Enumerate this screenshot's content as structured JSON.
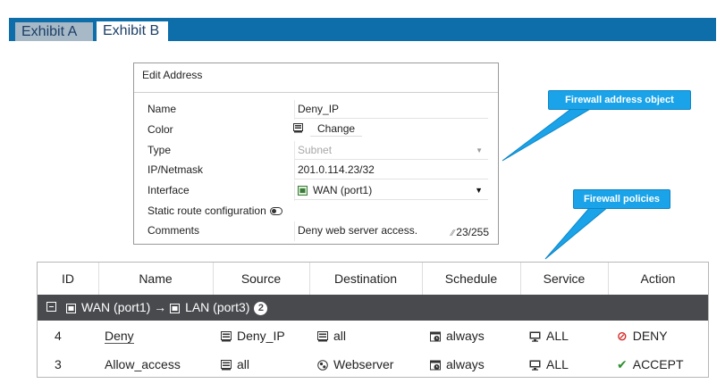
{
  "tabs": [
    {
      "label": "Exhibit A",
      "active": false
    },
    {
      "label": "Exhibit B",
      "active": true
    }
  ],
  "dialog": {
    "title": "Edit Address",
    "fields": {
      "name": {
        "label": "Name",
        "value": "Deny_IP"
      },
      "color": {
        "label": "Color",
        "button": "Change"
      },
      "type": {
        "label": "Type",
        "value": "Subnet"
      },
      "ipnetmask": {
        "label": "IP/Netmask",
        "value": "201.0.114.23/32"
      },
      "interface": {
        "label": "Interface",
        "value": "WAN (port1)"
      },
      "static_route": {
        "label": "Static route configuration"
      },
      "comments": {
        "label": "Comments",
        "value": "Deny web server access.",
        "counter": "23/255"
      }
    }
  },
  "callouts": {
    "address": "Firewall address object",
    "policies": "Firewall policies"
  },
  "table": {
    "headers": [
      "ID",
      "Name",
      "Source",
      "Destination",
      "Schedule",
      "Service",
      "Action"
    ],
    "group": {
      "label": "WAN (port1) → LAN (port3)",
      "from": "WAN (port1)",
      "arrow": "→",
      "to": "LAN (port3)",
      "count": "2"
    },
    "rows": [
      {
        "id": "4",
        "name": "Deny",
        "source": "Deny_IP",
        "destination": "all",
        "schedule": "always",
        "service": "ALL",
        "action": "DENY"
      },
      {
        "id": "3",
        "name": "Allow_access",
        "source": "all",
        "destination": "Webserver",
        "schedule": "always",
        "service": "ALL",
        "action": "ACCEPT"
      }
    ]
  },
  "colors": {
    "tabbar": "#0d6eaa",
    "callout": "#1aa3e8",
    "group_header": "#484a4e",
    "deny": "#d62b2b",
    "accept": "#2f8f2f"
  }
}
